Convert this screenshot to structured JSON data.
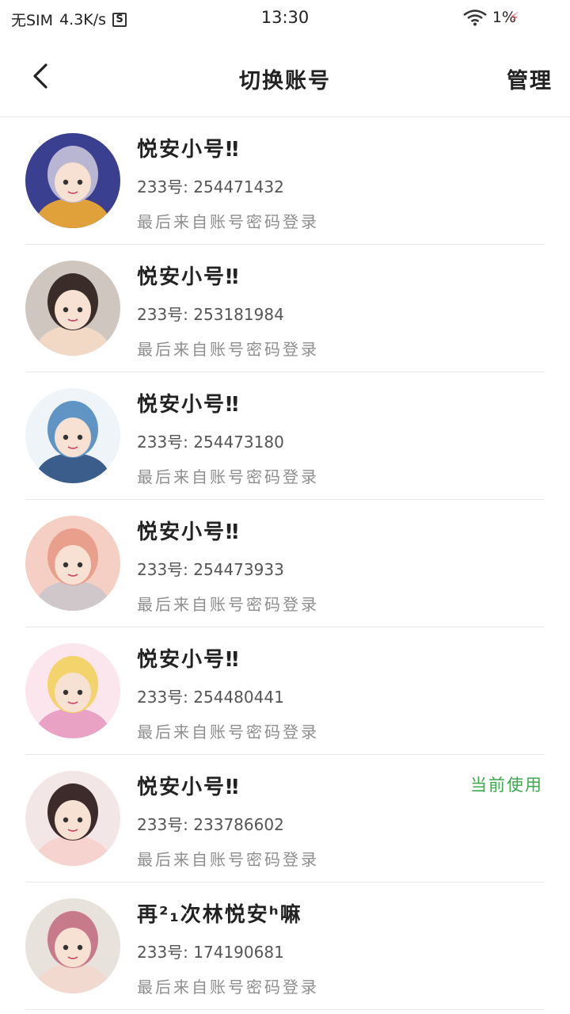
{
  "status_bar": {
    "carrier": "无SIM",
    "speed": "4.3K/s",
    "app_badge": "S",
    "time": "13:30",
    "battery": "1%"
  },
  "header": {
    "title": "切换账号",
    "manage_label": "管理"
  },
  "accounts": [
    {
      "name": "悦安小号‼",
      "uid": "233号: 254471432",
      "login": "最后来自账号密码登录",
      "current_label": "",
      "colors": [
        "#3b3f8f",
        "#b9b6d4",
        "#e0a13a"
      ]
    },
    {
      "name": "悦安小号‼",
      "uid": "233号: 253181984",
      "login": "最后来自账号密码登录",
      "current_label": "",
      "colors": [
        "#cfc6c0",
        "#3a2c28",
        "#f1d9c6"
      ]
    },
    {
      "name": "悦安小号‼",
      "uid": "233号: 254473180",
      "login": "最后来自账号密码登录",
      "current_label": "",
      "colors": [
        "#eef4f8",
        "#5f94c4",
        "#3b5d8c"
      ]
    },
    {
      "name": "悦安小号‼",
      "uid": "233号: 254473933",
      "login": "最后来自账号密码登录",
      "current_label": "",
      "colors": [
        "#f6cfc4",
        "#e89f8c",
        "#cfc7c9"
      ]
    },
    {
      "name": "悦安小号‼",
      "uid": "233号: 254480441",
      "login": "最后来自账号密码登录",
      "current_label": "",
      "colors": [
        "#fbe6ee",
        "#f3d36b",
        "#e9a2c4"
      ]
    },
    {
      "name": "悦安小号‼",
      "uid": "233号: 233786602",
      "login": "最后来自账号密码登录",
      "current_label": "当前使用",
      "colors": [
        "#f3e6e6",
        "#3d2a2a",
        "#f6d3cf"
      ]
    },
    {
      "name": "再²₁次林悦安ʰ嘛",
      "uid": "233号: 174190681",
      "login": "最后来自账号密码登录",
      "current_label": "",
      "colors": [
        "#e7e2dc",
        "#c77b8a",
        "#f2d9cf"
      ]
    }
  ],
  "colors": {
    "accent_green": "#3ea84d",
    "divider": "#e8e8e8"
  }
}
